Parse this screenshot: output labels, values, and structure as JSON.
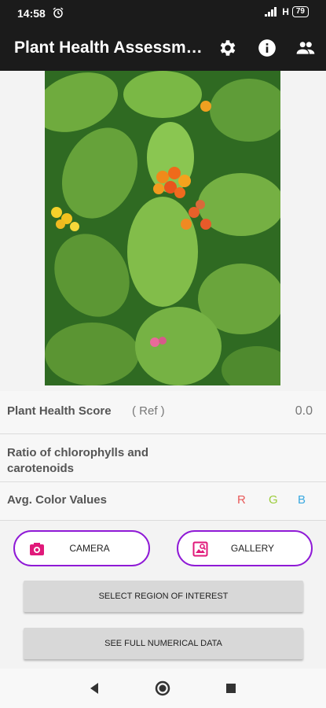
{
  "status": {
    "time": "14:58",
    "network": "H",
    "battery": "79"
  },
  "app": {
    "title": "Plant Health Assessment"
  },
  "metrics": {
    "score_label": "Plant Health Score",
    "score_ref": "( Ref )",
    "score_value": "0.0",
    "ratio_label": "Ratio of chlorophylls and carotenoids",
    "avg_label": "Avg. Color Values",
    "r": "R",
    "g": "G",
    "b": "B"
  },
  "actions": {
    "camera": "CAMERA",
    "gallery": "GALLERY",
    "select_roi": "SELECT REGION OF INTEREST",
    "full_data": "SEE FULL NUMERICAL DATA"
  },
  "colors": {
    "accent": "#8f1ad6",
    "icon_pink": "#e0197a",
    "r": "#e85a5a",
    "g": "#9ccc3a",
    "b": "#3aa9e0"
  }
}
